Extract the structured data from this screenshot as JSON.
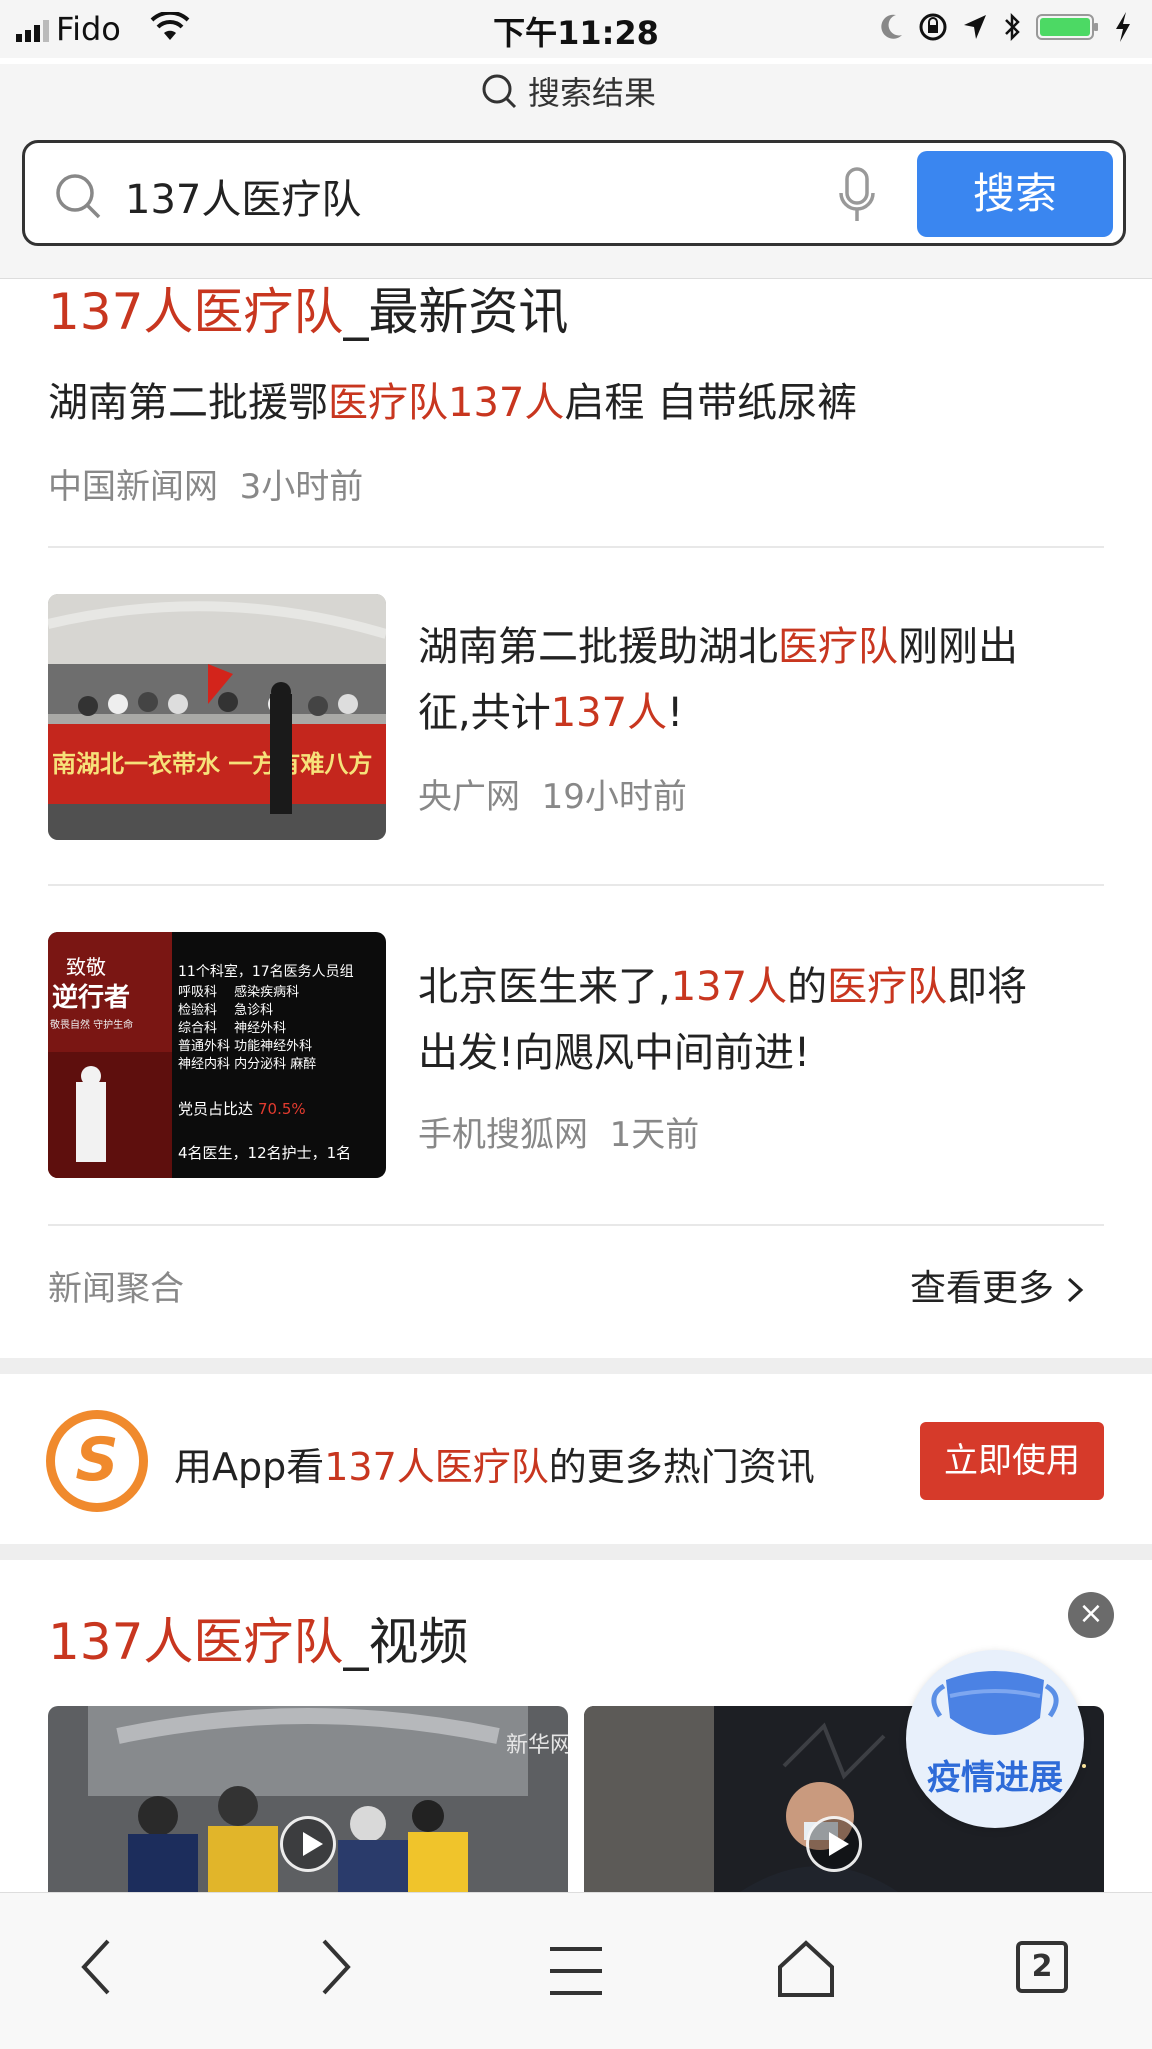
{
  "status_bar": {
    "carrier": "Fido",
    "time": "下午11:28"
  },
  "page_header": {
    "title": "搜索结果"
  },
  "search": {
    "query": "137人医疗队",
    "button_label": "搜索"
  },
  "news_section": {
    "title_highlight": "137人医疗队",
    "title_suffix": "_最新资讯",
    "items": [
      {
        "parts": [
          "湖南第二批援鄂",
          "医疗队137人",
          "启程 自带纸尿裤"
        ],
        "source": "中国新闻网",
        "time": "3小时前"
      },
      {
        "line1": [
          "湖南第二批援助湖北",
          "医疗队",
          "刚刚出"
        ],
        "line2": [
          "征,共计",
          "137人",
          "!"
        ],
        "source": "央广网",
        "time": "19小时前",
        "thumb_text": "南湖北一衣带水 一方有难八方"
      },
      {
        "line1": [
          "北京医生来了,",
          "137人",
          "的",
          "医疗队",
          "即将"
        ],
        "line2": [
          "出发!向飓风中间前进!"
        ],
        "source": "手机搜狐网",
        "time": "1天前",
        "thumb_left_title": "致敬",
        "thumb_left_sub": "逆行者",
        "thumb_left_small": "敬畏自然 守护生命",
        "thumb_right_lines": [
          "11个科室，17名医务人员组",
          "呼吸科　 感染疾病科",
          "检验科　 急诊科",
          "综合科　 神经外科",
          "普通外科 功能神经外科",
          "神经内科 内分泌科 麻醉"
        ],
        "thumb_ratio_label": "党员占比达",
        "thumb_ratio_value": "70.5%",
        "thumb_bottom": "4名医生，12名护士，1名"
      }
    ],
    "footer_left": "新闻聚合",
    "footer_right": "查看更多"
  },
  "app_promo": {
    "logo_letter": "S",
    "text_prefix": "用App看",
    "text_highlight": "137人医疗队",
    "text_suffix": "的更多热门资讯",
    "button_label": "立即使用"
  },
  "video_section": {
    "title_highlight": "137人医疗队",
    "title_suffix": "_视频",
    "watermark": "新华网"
  },
  "floating": {
    "label": "疫情进展",
    "close": "×"
  },
  "toolbar": {
    "tab_count": "2"
  }
}
